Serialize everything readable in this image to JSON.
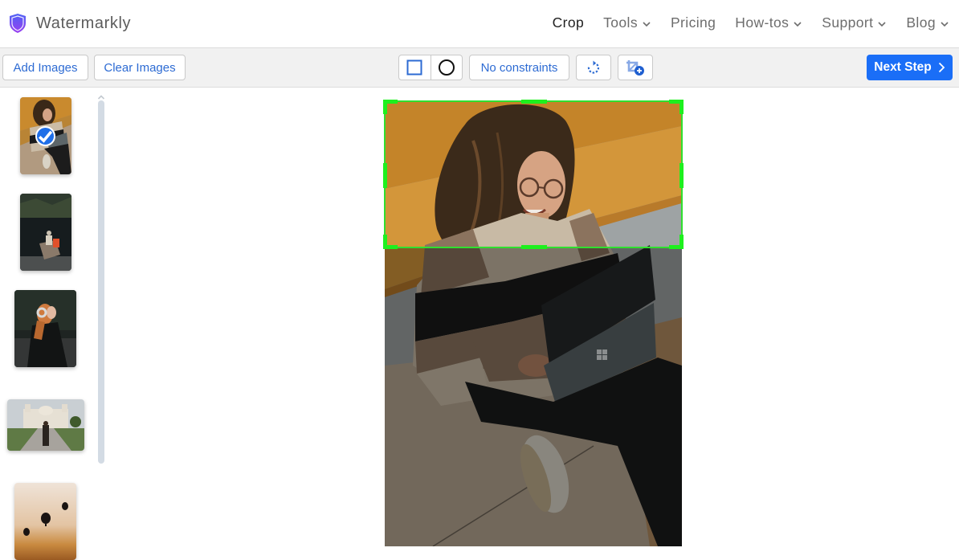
{
  "app": {
    "name": "Watermarkly",
    "logo_icon": "shield-icon"
  },
  "nav": {
    "items": [
      {
        "label": "Crop",
        "active": true,
        "has_dropdown": false
      },
      {
        "label": "Tools",
        "active": false,
        "has_dropdown": true
      },
      {
        "label": "Pricing",
        "active": false,
        "has_dropdown": false
      },
      {
        "label": "How-tos",
        "active": false,
        "has_dropdown": true
      },
      {
        "label": "Support",
        "active": false,
        "has_dropdown": true
      },
      {
        "label": "Blog",
        "active": false,
        "has_dropdown": true
      }
    ]
  },
  "toolbar": {
    "add_images": "Add Images",
    "clear_images": "Clear Images",
    "shape_options": [
      {
        "name": "rectangle",
        "icon": "square-icon",
        "selected": true
      },
      {
        "name": "circle",
        "icon": "circle-icon",
        "selected": false
      }
    ],
    "constraints": "No constraints",
    "rotate_icon": "rotate-icon",
    "add_crop_icon": "add-crop-icon",
    "next_step": "Next Step"
  },
  "thumbnails": [
    {
      "subject": "Woman with curly hair using a laptop",
      "selected": true
    },
    {
      "subject": "Person in a boat on a dark lake",
      "selected": false
    },
    {
      "subject": "Red-haired woman wearing headphones",
      "selected": false
    },
    {
      "subject": "Woman walking toward a white monument",
      "selected": false
    },
    {
      "subject": "Hot air balloons at sunset",
      "selected": false
    }
  ],
  "editor": {
    "image_subject": "Woman with curly hair using a laptop",
    "crop_shape": "rectangle",
    "constraint": "No constraints"
  },
  "colors": {
    "accent": "#1a6ef7",
    "link_blue": "#2d6bd3",
    "crop_frame": "#2fe02f",
    "toolbar_bg": "#f1f1f1",
    "scrollbar": "#d3dbe4"
  }
}
